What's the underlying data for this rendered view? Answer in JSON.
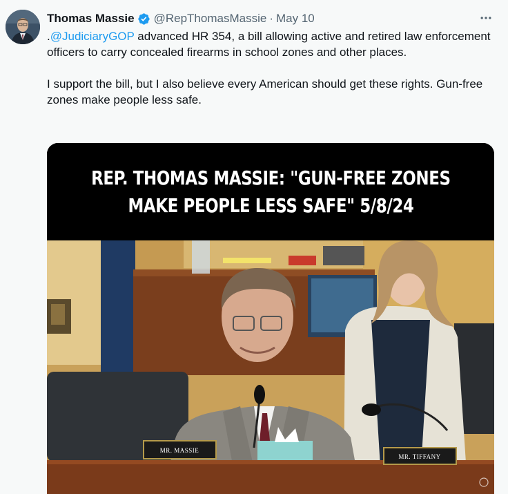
{
  "author": {
    "name": "Thomas Massie",
    "handle": "@RepThomasMassie",
    "separator": "·",
    "date": "May 10",
    "verified_icon": "verified-badge-icon",
    "avatar_icon": "profile-avatar"
  },
  "more_icon": "more-horizontal-icon",
  "tweet": {
    "prefix": ".",
    "mention": "@JudiciaryGOP",
    "line1_rest": " advanced HR 354, a bill allowing active and retired law enforcement officers to carry concealed firearms in school zones and other places.",
    "line2": "I support the bill, but I also believe every American should get these rights. Gun-free zones make people less safe."
  },
  "media": {
    "banner_line1": "REP. THOMAS MASSIE: \"GUN-FREE ZONES",
    "banner_line2": "MAKE PEOPLE LESS SAFE\" 5/8/24",
    "nameplate_left": "MR. MASSIE",
    "nameplate_right": "MR. TIFFANY"
  },
  "colors": {
    "link": "#1d9bf0",
    "secondary_text": "#536471",
    "verified": "#1d9bf0",
    "background": "#f7f9f9"
  }
}
